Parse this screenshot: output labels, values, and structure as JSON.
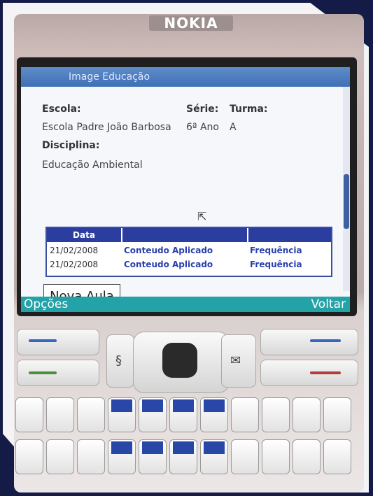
{
  "device": {
    "brand": "NOKIA"
  },
  "app": {
    "title": "Image Educação"
  },
  "fields": {
    "school_label": "Escola:",
    "school_value": "Escola Padre João Barbosa",
    "grade_label": "Série:",
    "grade_value": "6ª Ano",
    "class_label": "Turma:",
    "class_value": "A",
    "subject_label": "Disciplina:",
    "subject_value": "Educação Ambiental"
  },
  "table": {
    "columns": [
      "Data",
      "",
      ""
    ],
    "rows": [
      {
        "date": "21/02/2008",
        "content": "Conteudo Aplicado",
        "attendance": "Frequência"
      },
      {
        "date": "21/02/2008",
        "content": "Conteudo Aplicado",
        "attendance": "Frequência"
      }
    ]
  },
  "buttons": {
    "new_lesson": "Nova Aula"
  },
  "softkeys": {
    "left": "Opções",
    "right": "Voltar"
  },
  "colors": {
    "title_bar": "#3f6fb6",
    "table_header": "#2b3d9e",
    "link": "#2a3fb0",
    "softkey_bar": "#23a2a8"
  }
}
